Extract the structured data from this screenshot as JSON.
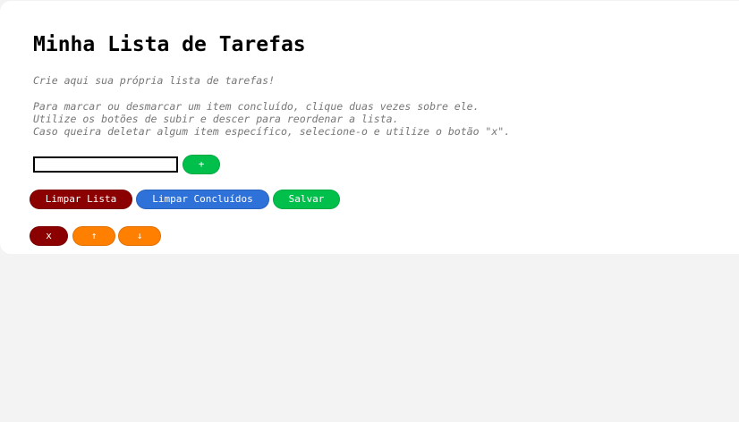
{
  "app": {
    "title": "Minha Lista de Tarefas",
    "subtitle": "Crie aqui sua própria lista de tarefas!",
    "instructions": [
      "Para marcar ou desmarcar um item concluído, clique duas vezes sobre ele.",
      "Utilize os botões de subir e descer para reordenar a lista.",
      "Caso queira deletar algum item específico, selecione-o e utilize o botão \"x\"."
    ]
  },
  "task_input": {
    "value": "",
    "placeholder": ""
  },
  "buttons": {
    "add_label": "+",
    "clear_list_label": "Limpar Lista",
    "clear_done_label": "Limpar Concluídos",
    "save_label": "Salvar",
    "delete_label": "x",
    "move_up_label": "↑",
    "move_down_label": "↓"
  },
  "colors": {
    "page_background": "#f3f3f3",
    "card_background": "#ffffff",
    "green": "#00c04b",
    "dark_red": "#8b0000",
    "blue": "#2e71d8",
    "orange": "#ff8000",
    "muted_text": "#777777"
  }
}
